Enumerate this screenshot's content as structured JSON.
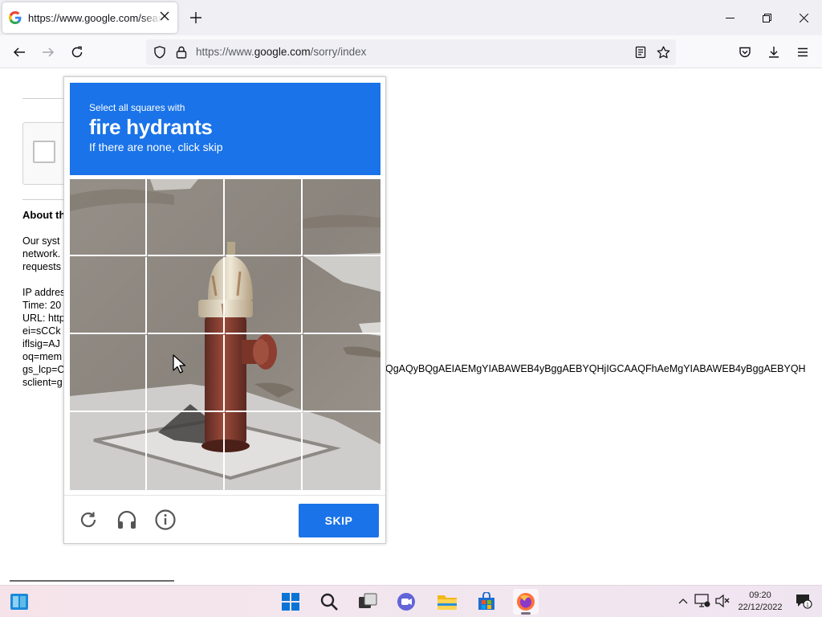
{
  "browser": {
    "tab": {
      "title": "https://www.google.com/search",
      "favicon": "G"
    },
    "url_bar": {
      "prefix": "https://www.",
      "domain": "google.com",
      "path": "/sorry/index"
    }
  },
  "page": {
    "about_heading": "About th",
    "lines": [
      "Our syst",
      "network.",
      "requests",
      "",
      "IP addres",
      "Time: 20",
      "URL: http",
      "ei=sCCk",
      "iflsig=AJ",
      "oq=mem",
      "gs_lcp=C",
      "sclient=g"
    ],
    "long_line": "QgAQyBQgAEIAEMgYIABAWEB4yBggAEBYQHjIGCAAQFhAeMgYIABAWEB4yBggAEBYQH"
  },
  "captcha": {
    "instruction": "Select all squares with",
    "target": "fire hydrants",
    "hint": "If there are none, click skip",
    "skip_label": "SKIP",
    "grid": {
      "rows": 4,
      "cols": 4
    }
  },
  "taskbar": {
    "clock_time": "09:20",
    "clock_date": "22/12/2022",
    "notification_count": "1"
  },
  "colors": {
    "captcha_blue": "#1a73e8",
    "firefox_orange": "#ff7139"
  }
}
